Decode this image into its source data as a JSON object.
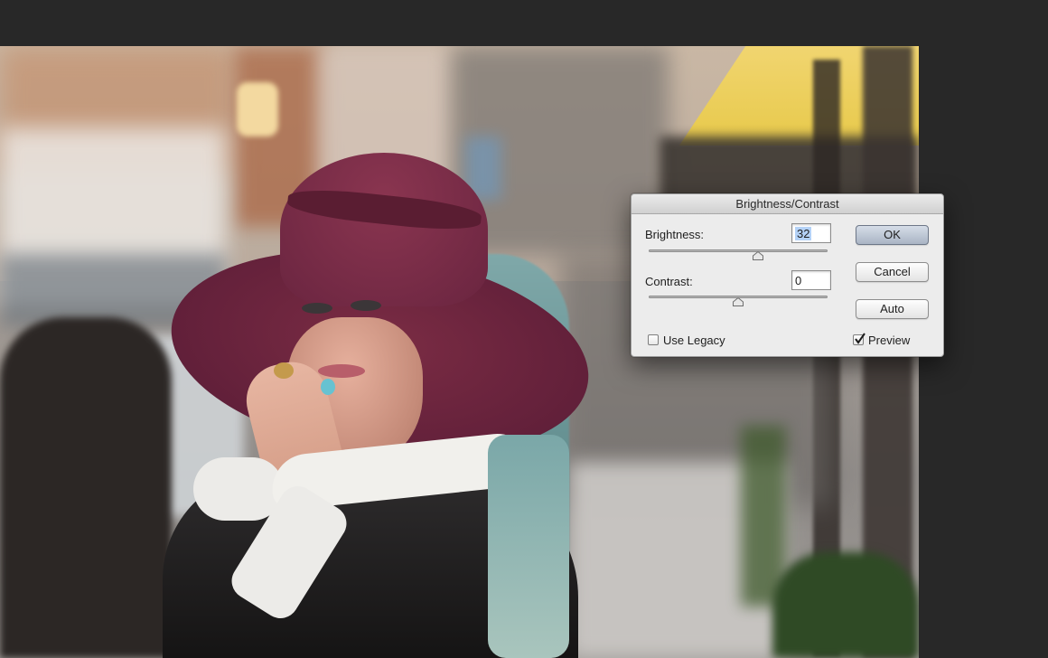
{
  "dialog": {
    "title": "Brightness/Contrast",
    "brightness_label": "Brightness:",
    "brightness_value": "32",
    "brightness_slider_fraction": 0.61,
    "contrast_label": "Contrast:",
    "contrast_value": "0",
    "contrast_slider_fraction": 0.5,
    "ok_label": "OK",
    "cancel_label": "Cancel",
    "auto_label": "Auto",
    "use_legacy_label": "Use Legacy",
    "use_legacy_checked": false,
    "preview_label": "Preview",
    "preview_checked": true
  },
  "icons": {
    "slider_thumb": "triangle-thumb-icon",
    "checkmark": "checkmark-icon"
  },
  "colors": {
    "workspace": "#282828",
    "dialog_bg": "#ececec",
    "default_button": "#a9b4c4",
    "selection": "#b4d2f7"
  }
}
